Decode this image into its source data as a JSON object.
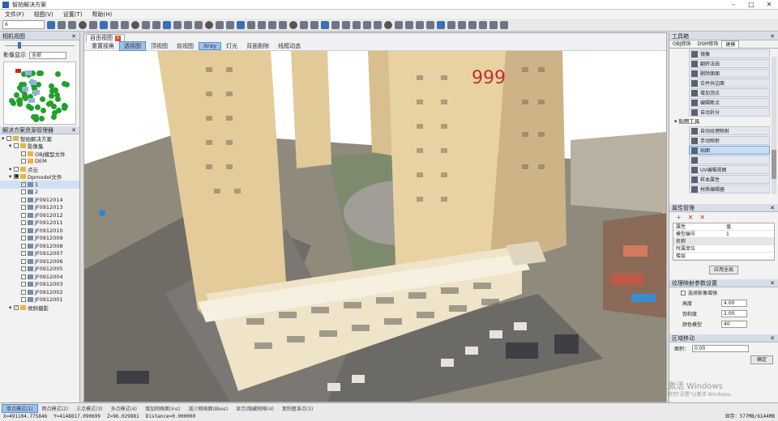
{
  "app": {
    "title": "智拍解决方案"
  },
  "window_buttons": {
    "min": "–",
    "max": "□",
    "close": "✕"
  },
  "menu": [
    "文件(F)",
    "视图(V)",
    "设置(T)",
    "帮助(H)"
  ],
  "toolbar": {
    "combo_value": "6"
  },
  "left": {
    "cam_title": "相机视图",
    "image_label": "影像显示",
    "image_select": "全部",
    "tree_title": "解决方案资源管理器",
    "tree": [
      {
        "label": "智拍解决方案",
        "indent": 0,
        "type": "folder",
        "check": ""
      },
      {
        "label": "影像集",
        "indent": 1,
        "type": "folder",
        "check": ""
      },
      {
        "label": "OBJ模型文件",
        "indent": 2,
        "type": "folder",
        "check": ""
      },
      {
        "label": "DEM",
        "indent": 2,
        "type": "folder",
        "check": ""
      },
      {
        "label": "点云",
        "indent": 1,
        "type": "folder",
        "check": ""
      },
      {
        "label": "Dpmodel文件",
        "indent": 1,
        "type": "folder",
        "check": "■"
      },
      {
        "label": "1",
        "indent": 2,
        "type": "layer",
        "check": "✓",
        "selected": true
      },
      {
        "label": "2",
        "indent": 2,
        "type": "layer",
        "check": ""
      },
      {
        "label": "JF0912014",
        "indent": 2,
        "type": "layer",
        "check": ""
      },
      {
        "label": "JF0912013",
        "indent": 2,
        "type": "layer",
        "check": ""
      },
      {
        "label": "JF0912012",
        "indent": 2,
        "type": "layer",
        "check": ""
      },
      {
        "label": "JF0912011",
        "indent": 2,
        "type": "layer",
        "check": ""
      },
      {
        "label": "JF0912010",
        "indent": 2,
        "type": "layer",
        "check": ""
      },
      {
        "label": "JF0912009",
        "indent": 2,
        "type": "layer",
        "check": ""
      },
      {
        "label": "JF0912008",
        "indent": 2,
        "type": "layer",
        "check": ""
      },
      {
        "label": "JF0912007",
        "indent": 2,
        "type": "layer",
        "check": ""
      },
      {
        "label": "JF0912006",
        "indent": 2,
        "type": "layer",
        "check": ""
      },
      {
        "label": "JF0912005",
        "indent": 2,
        "type": "layer",
        "check": ""
      },
      {
        "label": "JF0912004",
        "indent": 2,
        "type": "layer",
        "check": ""
      },
      {
        "label": "JF0912003",
        "indent": 2,
        "type": "layer",
        "check": ""
      },
      {
        "label": "JF0912002",
        "indent": 2,
        "type": "layer",
        "check": ""
      },
      {
        "label": "JF0912001",
        "indent": 2,
        "type": "layer",
        "check": ""
      },
      {
        "label": "倾斜摄影",
        "indent": 1,
        "type": "folder",
        "check": "✓"
      }
    ]
  },
  "center": {
    "tab": "自由视图",
    "tab_close": "×",
    "view_modes": [
      {
        "label": "重置视角",
        "on": false
      },
      {
        "label": "透视图",
        "on": true
      },
      {
        "label": "顶视图",
        "on": false
      },
      {
        "label": "前视图",
        "on": false
      },
      {
        "label": "Xray",
        "on": true
      },
      {
        "label": "灯光",
        "on": false
      },
      {
        "label": "背面剔除",
        "on": false
      },
      {
        "label": "线框动态",
        "on": false
      }
    ],
    "sign_text": "999"
  },
  "right": {
    "title": "工具箱",
    "tabs": [
      {
        "label": "OBJ修饰",
        "on": false
      },
      {
        "label": "DSM修饰",
        "on": false
      },
      {
        "label": "建模",
        "on": true
      }
    ],
    "tools_top": [
      "镜像",
      "翻转法线",
      "删除面面",
      "合并共边面",
      "增加顶点",
      "编辑断点",
      "自动拆分"
    ],
    "group": "贴图工具",
    "tools_bottom": [
      {
        "label": "自动纹理映射",
        "hl": false
      },
      {
        "label": "手动映射",
        "hl": false
      },
      {
        "label": "贴图",
        "hl": true
      },
      {
        "label": "",
        "hl": false
      },
      {
        "label": "UV编辑视图",
        "hl": false
      },
      {
        "label": "样本属性",
        "hl": false
      },
      {
        "label": "材质编辑器",
        "hl": false
      }
    ],
    "props_title": "属性管理",
    "props_buttons": [
      "+",
      "✕",
      "✕"
    ],
    "props_rows": [
      [
        "属性",
        "值"
      ],
      [
        "模型编号",
        "1"
      ],
      [
        "名称",
        ""
      ],
      [
        "所属单位",
        ""
      ],
      [
        "楼层",
        ""
      ]
    ],
    "props_apply": "应用全局",
    "tex_title": "纹理映射参数设置",
    "tex_check": "选择影像增强",
    "tex_fields": [
      [
        "高度",
        "4.00"
      ],
      [
        "饱和度",
        "2.00"
      ],
      [
        "颜色模型",
        "40"
      ]
    ],
    "move_title": "区域移动",
    "move_label": "面积：",
    "move_value": "0.00",
    "move_btn": "确定"
  },
  "status": {
    "modes": [
      {
        "label": "单点模式(1)",
        "on": true
      },
      {
        "label": "两点模式(2)",
        "on": false
      },
      {
        "label": "三点模式(3)",
        "on": false
      },
      {
        "label": "多点模式(4)",
        "on": false
      },
      {
        "label": "增加网格面(Ins)",
        "on": false
      },
      {
        "label": "减少网格面(Bkes)",
        "on": false
      },
      {
        "label": "显示/隐藏网格(4)",
        "on": false
      },
      {
        "label": "复制基准点(3)",
        "on": false
      }
    ],
    "x": "X=491104.775846",
    "y": "Y=4148817.090699",
    "z": "Z=96.029881",
    "distance": "Distance=0.000000",
    "memory": "显存：577MB/6144MB"
  },
  "watermark": {
    "line1": "激活 Windows",
    "line2": "转到\"设置\"以激活 Windows。"
  },
  "colors": {
    "accent": "#3b6fb6",
    "tree_folder": "#e8b640",
    "green": "#22a02a"
  }
}
